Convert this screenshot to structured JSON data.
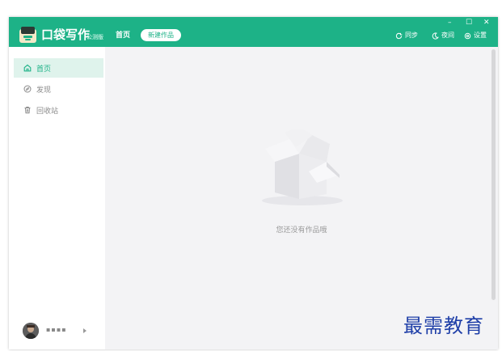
{
  "app": {
    "name": "口袋写作",
    "badge": "公测版"
  },
  "header": {
    "nav_home": "首页",
    "new_work": "新建作品",
    "sync": "同步",
    "night": "夜间",
    "settings": "设置",
    "minimize": "–",
    "maximize": "☐",
    "close": "✕"
  },
  "sidebar": {
    "items": [
      {
        "label": "首页",
        "icon": "home-icon",
        "active": true
      },
      {
        "label": "发现",
        "icon": "compass-icon",
        "active": false
      },
      {
        "label": "回收站",
        "icon": "trash-icon",
        "active": false
      }
    ],
    "user_name": "▪▪▪▪"
  },
  "main": {
    "empty_message": "您还没有作品哦"
  },
  "watermark": "最需教育",
  "colors": {
    "brand": "#1db287",
    "active_bg": "#dff3ec",
    "content_bg": "#f3f3f5"
  }
}
